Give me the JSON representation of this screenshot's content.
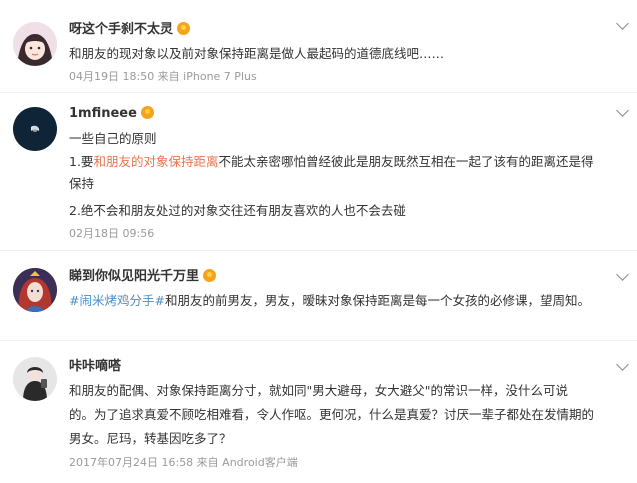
{
  "comments": [
    {
      "username": "呀这个手刹不太灵",
      "lines": [
        "和朋友的现对象以及前对象保持距离是做人最起码的道德底线吧……"
      ],
      "meta": "04月19日 18:50 来自 iPhone 7 Plus"
    },
    {
      "username": "1mfineee",
      "line1": "一些自己的原则",
      "line2_pre": "1.要",
      "line2_hl": "和朋友的对象保持距离",
      "line2_post": "不能太亲密哪怕曾经彼此是朋友既然互相在一起了该有的距离还是得",
      "line3": "保持",
      "line4": "2.绝不会和朋友处过的对象交往还有朋友喜欢的人也不会去碰",
      "meta": "02月18日 09:56"
    },
    {
      "username": "睇到你似见阳光千万里",
      "topic": "#闹米烤鸡分手#",
      "text": "和朋友的前男友，男友，暧昧对象保持距离是每一个女孩的必修课，望周知。"
    },
    {
      "username": "咔咔嘀嗒",
      "lines": [
        "和朋友的配偶、对象保持距离分寸，就如同\"男大避母，女大避父\"的常识一样，没什么可说",
        "的。为了追求真爱不顾吃相难看，令人作呕。更何况，什么是真爱？讨厌一辈子都处在发情期的",
        "男女。尼玛，转基因吃多了？"
      ],
      "meta": "2017年07月24日 16:58 来自 Android客户端"
    }
  ],
  "colors": {
    "highlight": "#eb7350",
    "topic_link": "#4b8ec8",
    "meta_gray": "#9a9a9a",
    "badge": "#f7a21b"
  },
  "icons": [
    "vip-badge-icon",
    "chevron-down-icon"
  ]
}
